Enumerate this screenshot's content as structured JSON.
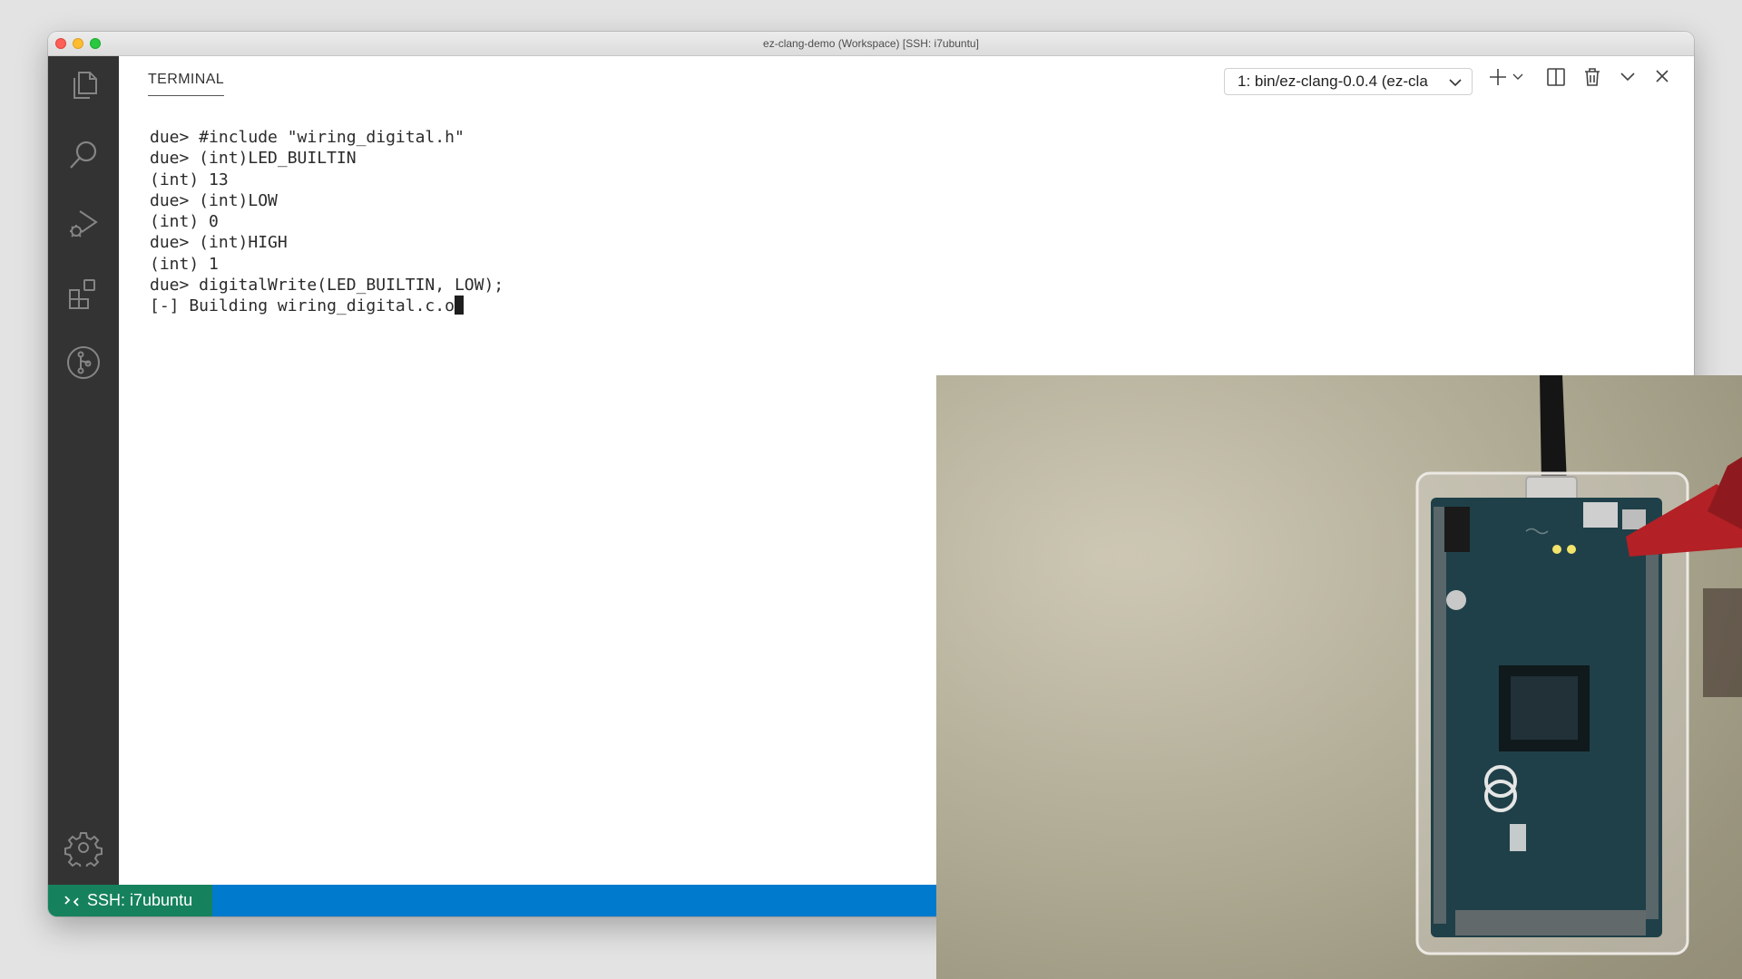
{
  "window": {
    "title": "ez-clang-demo (Workspace) [SSH: i7ubuntu]"
  },
  "activity_bar": {
    "items": [
      {
        "name": "explorer-icon"
      },
      {
        "name": "search-icon"
      },
      {
        "name": "run-debug-icon"
      },
      {
        "name": "extensions-icon"
      },
      {
        "name": "source-control-icon"
      },
      {
        "name": "gear-icon"
      }
    ]
  },
  "panel": {
    "tab_label": "TERMINAL",
    "terminal_select": "1: bin/ez-clang-0.0.4 (ez-cla",
    "actions": [
      "plus-icon",
      "chevron-down-icon",
      "split-icon",
      "trash-icon",
      "chevron-down-icon",
      "close-icon"
    ]
  },
  "terminal": {
    "lines": [
      "due> #include \"wiring_digital.h\"",
      "due> (int)LED_BUILTIN",
      "(int) 13",
      "due> (int)LOW",
      "(int) 0",
      "due> (int)HIGH",
      "(int) 1",
      "due> digitalWrite(LED_BUILTIN, LOW);",
      "[-] Building wiring_digital.c.o"
    ]
  },
  "statusbar": {
    "remote": "SSH: i7ubuntu"
  },
  "colors": {
    "activity_bar": "#333333",
    "statusbar": "#007acc",
    "remote_indicator": "#16825d",
    "board_pcb": "#1f4048"
  }
}
